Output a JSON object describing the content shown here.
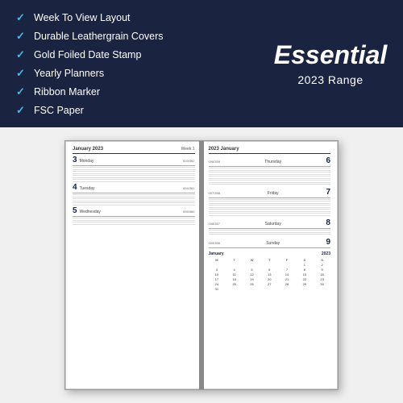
{
  "banner": {
    "background": "#1a2340",
    "features": [
      {
        "id": "f1",
        "text": "Week To View Layout"
      },
      {
        "id": "f2",
        "text": "Durable Leathergrain Covers"
      },
      {
        "id": "f3",
        "text": "Gold Foiled Date Stamp"
      },
      {
        "id": "f4",
        "text": "Yearly Planners"
      },
      {
        "id": "f5",
        "text": "Ribbon Marker"
      },
      {
        "id": "f6",
        "text": "FSC Paper"
      }
    ],
    "title": {
      "line1": "Essential",
      "line2": "2023 Range"
    }
  },
  "diary": {
    "left_page": {
      "header_month": "January 2023",
      "header_week": "Week 1",
      "days": [
        {
          "number": "3",
          "name": "Monday",
          "info": "003/362",
          "lines": 8
        },
        {
          "number": "4",
          "name": "Tuesday",
          "info": "004/361",
          "lines": 6
        },
        {
          "number": "5",
          "name": "Wednesday",
          "info": "005/360",
          "lines": 4
        }
      ]
    },
    "right_page": {
      "header_left": "2023 January",
      "days": [
        {
          "number": "6",
          "name": "Thursday",
          "ref": "006/359",
          "lines": 9
        },
        {
          "number": "7",
          "name": "Friday",
          "ref": "007/358",
          "lines": 9
        },
        {
          "number": "8",
          "name": "Saturday",
          "ref": "008/357",
          "lines": 3
        },
        {
          "number": "9",
          "name": "Sunday",
          "ref": "009/356",
          "lines": 0
        }
      ],
      "mini_calendar": {
        "title": "January",
        "year": "2023",
        "day_headers": [
          "M",
          "T",
          "W",
          "T",
          "F",
          "S",
          "S"
        ],
        "weeks": [
          [
            "",
            "",
            "",
            "",
            "",
            "1",
            "2"
          ],
          [
            "3",
            "4",
            "5",
            "6",
            "7",
            "8",
            "9"
          ],
          [
            "10",
            "11",
            "12",
            "13",
            "14",
            "15",
            "16"
          ],
          [
            "17",
            "18",
            "19",
            "20",
            "21",
            "22",
            "23"
          ],
          [
            "24",
            "25",
            "26",
            "27",
            "28",
            "29",
            "30"
          ],
          [
            "31",
            "",
            "",
            "",
            "",
            "",
            ""
          ]
        ]
      }
    }
  },
  "icons": {
    "checkmark": "✓"
  }
}
